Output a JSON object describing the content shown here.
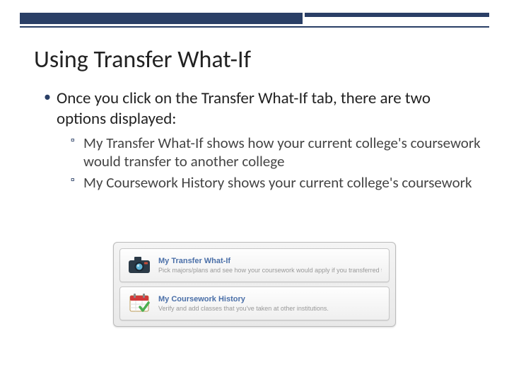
{
  "slide": {
    "title": "Using Transfer What-If",
    "bullets": [
      {
        "text": "Once you click on the Transfer What-If tab, there are two options displayed:",
        "sub": [
          "My Transfer What-If shows how your current college's coursework would transfer to another college",
          "My Coursework History shows your current college's coursework"
        ]
      }
    ]
  },
  "panel": {
    "cards": [
      {
        "icon": "camera-icon",
        "title": "My Transfer What-If",
        "desc": "Pick majors/plans and see how your coursework would apply if you transferred today."
      },
      {
        "icon": "calendar-check-icon",
        "title": "My Coursework History",
        "desc": "Verify and add classes that you've taken at other institutions."
      }
    ]
  }
}
